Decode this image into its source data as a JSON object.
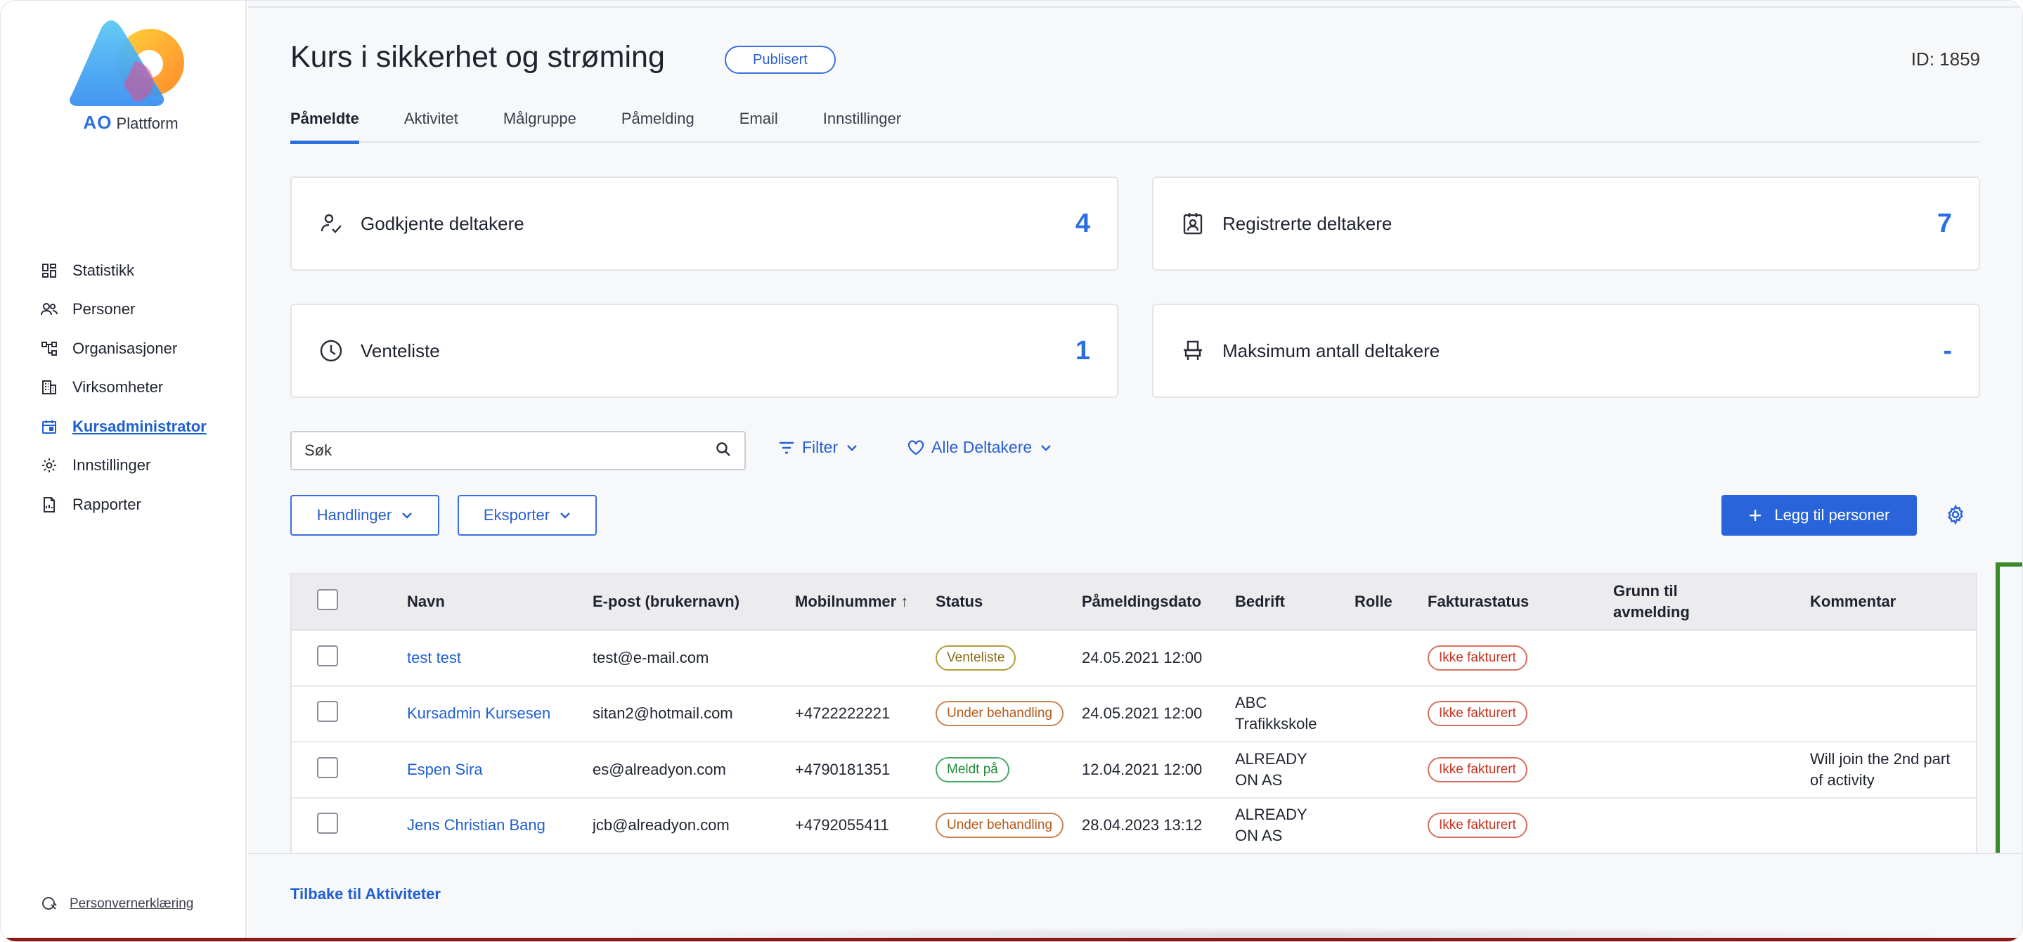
{
  "brand": {
    "logo_ao": "AO",
    "logo_rest": "Plattform",
    "colors": {
      "accent": "#2a64db",
      "highlight": "#3c8a2a"
    }
  },
  "sidebar": {
    "items": [
      {
        "label": "Statistikk",
        "icon": "dashboard-grid-icon"
      },
      {
        "label": "Personer",
        "icon": "people-icon"
      },
      {
        "label": "Organisasjoner",
        "icon": "org-tree-icon"
      },
      {
        "label": "Virksomheter",
        "icon": "building-icon"
      },
      {
        "label": "Kursadministrator",
        "icon": "calendar-icon",
        "active": true
      },
      {
        "label": "Innstillinger",
        "icon": "gear-icon"
      },
      {
        "label": "Rapporter",
        "icon": "report-icon"
      }
    ],
    "privacy_label": "Personvernerklæring"
  },
  "header": {
    "title": "Kurs i sikkerhet og strøming",
    "status": "Publisert",
    "id_label": "ID: 1859"
  },
  "tabs": [
    "Påmeldte",
    "Aktivitet",
    "Målgruppe",
    "Påmelding",
    "Email",
    "Innstillinger"
  ],
  "stats": [
    {
      "label": "Godkjente deltakere",
      "value": "4",
      "icon": "user-check-icon"
    },
    {
      "label": "Registrerte deltakere",
      "value": "7",
      "icon": "id-badge-icon"
    },
    {
      "label": "Venteliste",
      "value": "1",
      "icon": "clock-icon"
    },
    {
      "label": "Maksimum antall deltakere",
      "value": "-",
      "icon": "seat-icon"
    }
  ],
  "toolbar": {
    "search_placeholder": "Søk",
    "filter_label": "Filter",
    "participants_filter_label": "Alle Deltakere",
    "actions_label": "Handlinger",
    "export_label": "Eksporter",
    "add_people_label": "Legg til personer"
  },
  "table": {
    "columns": {
      "name": "Navn",
      "email": "E-post (brukernavn)",
      "mobile": "Mobilnummer",
      "status": "Status",
      "date": "Påmeldingsdato",
      "company": "Bedrift",
      "role": "Rolle",
      "invoice": "Fakturastatus",
      "reason_1": "Grunn til",
      "reason_2": "avmelding",
      "comment": "Kommentar"
    },
    "rows": [
      {
        "name": "test test",
        "email": "test@e-mail.com",
        "mobile": "",
        "status": "Venteliste",
        "status_kind": "venteliste",
        "date": "24.05.2021 12:00",
        "company_1": "",
        "company_2": "",
        "role": "",
        "invoice": "Ikke fakturert",
        "reason": "",
        "comment_1": "",
        "comment_2": ""
      },
      {
        "name": "Kursadmin Kursesen",
        "email": "sitan2@hotmail.com",
        "mobile": "+4722222221",
        "status": "Under behandling",
        "status_kind": "under",
        "date": "24.05.2021 12:00",
        "company_1": "ABC",
        "company_2": "Trafikkskole",
        "role": "",
        "invoice": "Ikke fakturert",
        "reason": "",
        "comment_1": "",
        "comment_2": ""
      },
      {
        "name": "Espen Sira",
        "email": "es@alreadyon.com",
        "mobile": "+4790181351",
        "status": "Meldt på",
        "status_kind": "meldt",
        "date": "12.04.2021 12:00",
        "company_1": "ALREADY",
        "company_2": "ON AS",
        "role": "",
        "invoice": "Ikke fakturert",
        "reason": "",
        "comment_1": "Will join the 2nd part",
        "comment_2": "of activity"
      },
      {
        "name": "Jens Christian Bang",
        "email": "jcb@alreadyon.com",
        "mobile": "+4792055411",
        "status": "Under behandling",
        "status_kind": "under",
        "date": "28.04.2023 13:12",
        "company_1": "ALREADY",
        "company_2": "ON AS",
        "role": "",
        "invoice": "Ikke fakturert",
        "reason": "",
        "comment_1": "",
        "comment_2": ""
      }
    ]
  },
  "footer": {
    "back_label": "Tilbake til Aktiviteter"
  }
}
